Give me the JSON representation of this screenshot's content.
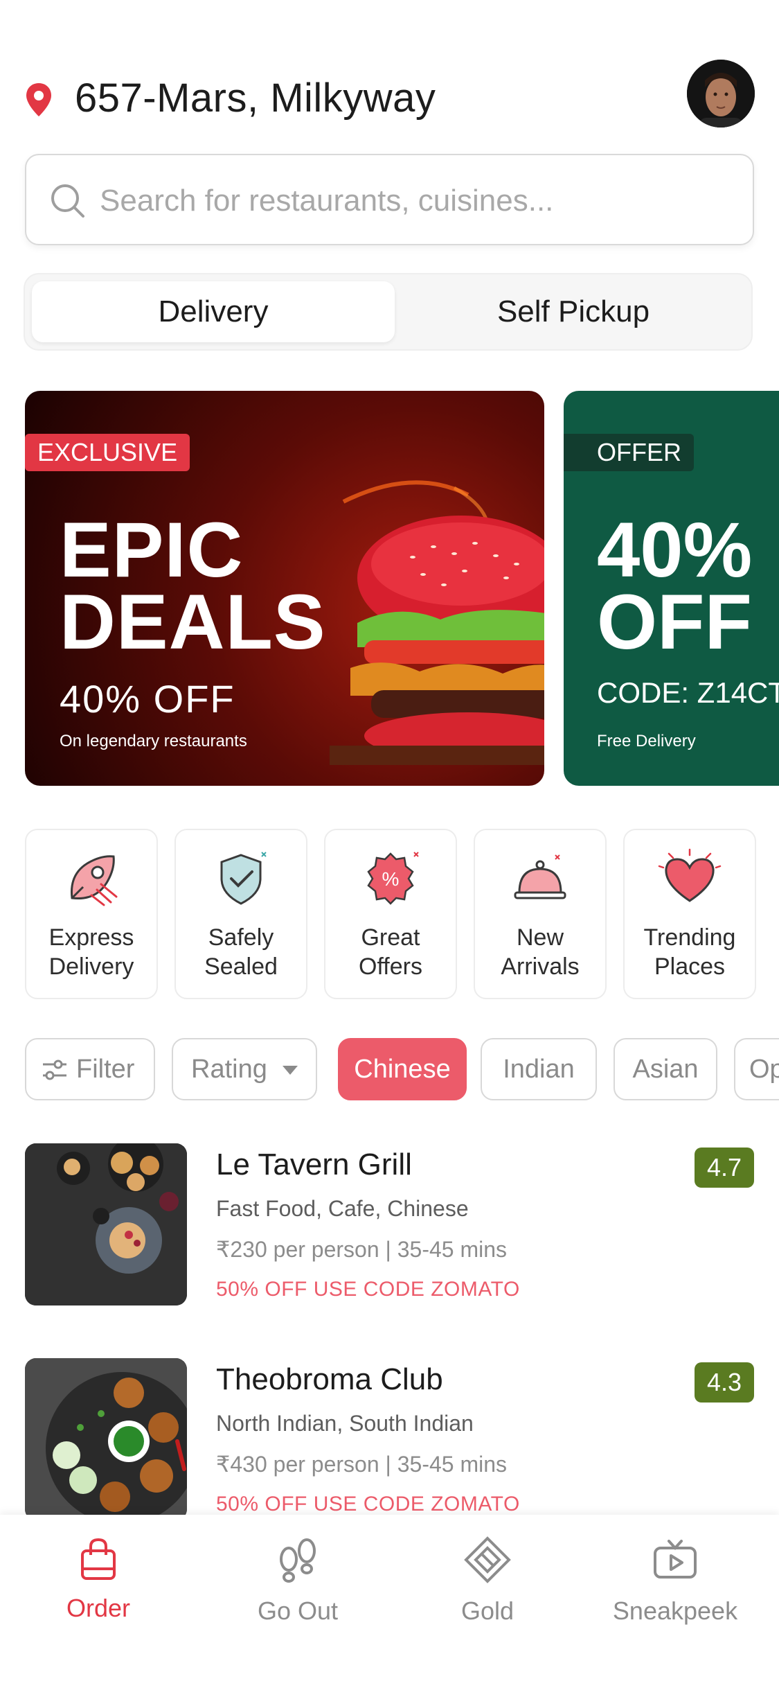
{
  "header": {
    "location": "657-Mars, Milkyway",
    "location_icon": "location-pin-icon",
    "avatar": "user-avatar"
  },
  "search": {
    "placeholder": "Search for restaurants, cuisines..."
  },
  "mode_toggle": {
    "options": [
      "Delivery",
      "Self Pickup"
    ],
    "selected": "Delivery"
  },
  "banners": [
    {
      "badge": "EXCLUSIVE",
      "title_line1": "EPIC",
      "title_line2": "DEALS",
      "subtitle": "40% OFF",
      "caption": "On legendary restaurants"
    },
    {
      "badge": "OFFER",
      "title_line1": "40%",
      "title_line2": "OFF",
      "code": "CODE: Z14CT",
      "caption": "Free Delivery"
    }
  ],
  "categories": [
    {
      "line1": "Express",
      "line2": "Delivery",
      "icon": "rocket-icon"
    },
    {
      "line1": "Safely",
      "line2": "Sealed",
      "icon": "shield-check-icon"
    },
    {
      "line1": "Great",
      "line2": "Offers",
      "icon": "percent-badge-icon"
    },
    {
      "line1": "New",
      "line2": "Arrivals",
      "icon": "cloche-icon"
    },
    {
      "line1": "Trending",
      "line2": "Places",
      "icon": "heart-icon"
    }
  ],
  "filters": {
    "filter_label": "Filter",
    "rating_label": "Rating",
    "cuisines": [
      "Chinese",
      "Indian",
      "Asian",
      "Op"
    ],
    "active": "Chinese"
  },
  "restaurants": [
    {
      "name": "Le Tavern Grill",
      "cuisine": "Fast Food, Cafe, Chinese",
      "price": "₹230 per person | 35-45 mins",
      "offer": "50% OFF USE CODE ZOMATO",
      "rating": "4.7"
    },
    {
      "name": "Theobroma Club",
      "cuisine": "North Indian, South Indian",
      "price": "₹430 per person | 35-45 mins",
      "offer": "50% OFF USE CODE ZOMATO",
      "rating": "4.3"
    }
  ],
  "bottom_nav": {
    "items": [
      {
        "label": "Order",
        "icon": "shopping-bag-icon"
      },
      {
        "label": "Go Out",
        "icon": "footprints-icon"
      },
      {
        "label": "Gold",
        "icon": "gold-diamond-icon"
      },
      {
        "label": "Sneakpeek",
        "icon": "tv-play-icon"
      }
    ],
    "active": "Order"
  },
  "colors": {
    "brand": "#e23744",
    "chip_active": "#ec5b6a",
    "rating_green": "#5a7b21",
    "offer_banner_green": "#0f5a43"
  }
}
